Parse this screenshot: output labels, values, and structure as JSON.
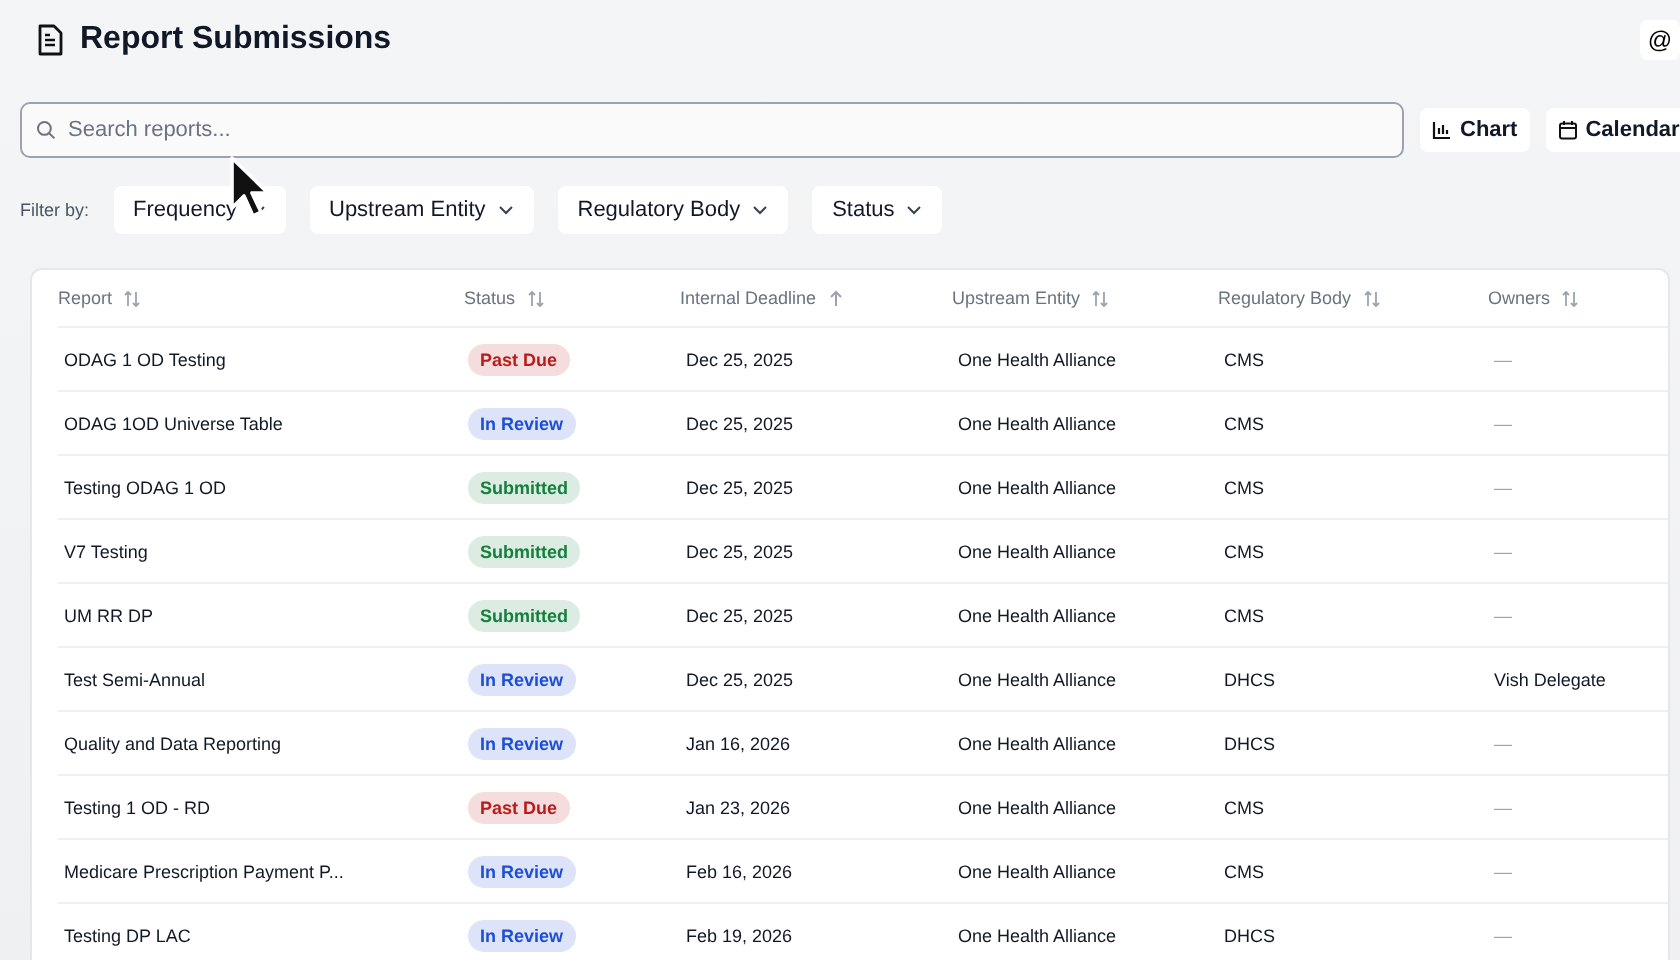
{
  "header": {
    "title": "Report Submissions",
    "user_button": "@"
  },
  "search": {
    "placeholder": "Search reports..."
  },
  "view_buttons": [
    {
      "label": "Chart",
      "kind": "chart"
    },
    {
      "label": "Calendar",
      "kind": "calendar"
    }
  ],
  "filters": {
    "label": "Filter by:",
    "items": [
      "Frequency",
      "Upstream Entity",
      "Regulatory Body",
      "Status"
    ]
  },
  "table": {
    "columns": [
      {
        "label": "Report",
        "sorted": false
      },
      {
        "label": "Status",
        "sorted": false
      },
      {
        "label": "Internal Deadline",
        "sorted": true
      },
      {
        "label": "Upstream Entity",
        "sorted": false
      },
      {
        "label": "Regulatory Body",
        "sorted": false
      },
      {
        "label": "Owners",
        "sorted": false
      }
    ],
    "rows": [
      {
        "report": "ODAG 1 OD Testing",
        "status": "Past Due",
        "color": "#b91c1c",
        "deadline": "Dec 25, 2025",
        "entity": "One Health Alliance",
        "body": "CMS",
        "owners": "—"
      },
      {
        "report": "ODAG 1OD Universe Table",
        "status": "In Review",
        "color": "#1d4ed8",
        "deadline": "Dec 25, 2025",
        "entity": "One Health Alliance",
        "body": "CMS",
        "owners": "—"
      },
      {
        "report": "Testing ODAG 1 OD",
        "status": "Submitted",
        "color": "#15803d",
        "deadline": "Dec 25, 2025",
        "entity": "One Health Alliance",
        "body": "CMS",
        "owners": "—"
      },
      {
        "report": "V7 Testing",
        "status": "Submitted",
        "color": "#15803d",
        "deadline": "Dec 25, 2025",
        "entity": "One Health Alliance",
        "body": "CMS",
        "owners": "—"
      },
      {
        "report": "UM RR DP",
        "status": "Submitted",
        "color": "#15803d",
        "deadline": "Dec 25, 2025",
        "entity": "One Health Alliance",
        "body": "CMS",
        "owners": "—"
      },
      {
        "report": "Test Semi-Annual",
        "status": "In Review",
        "color": "#1d4ed8",
        "deadline": "Dec 25, 2025",
        "entity": "One Health Alliance",
        "body": "DHCS",
        "owners": "Vish Delegate"
      },
      {
        "report": "Quality and Data Reporting",
        "status": "In Review",
        "color": "#1d4ed8",
        "deadline": "Jan 16, 2026",
        "entity": "One Health Alliance",
        "body": "DHCS",
        "owners": "—"
      },
      {
        "report": "Testing 1 OD - RD",
        "status": "Past Due",
        "color": "#b91c1c",
        "deadline": "Jan 23, 2026",
        "entity": "One Health Alliance",
        "body": "CMS",
        "owners": "—"
      },
      {
        "report": "Medicare Prescription Payment P...",
        "status": "In Review",
        "color": "#1d4ed8",
        "deadline": "Feb 16, 2026",
        "entity": "One Health Alliance",
        "body": "CMS",
        "owners": "—"
      },
      {
        "report": "Testing DP LAC",
        "status": "In Review",
        "color": "#1d4ed8",
        "deadline": "Feb 19, 2026",
        "entity": "One Health Alliance",
        "body": "DHCS",
        "owners": "—"
      }
    ]
  }
}
